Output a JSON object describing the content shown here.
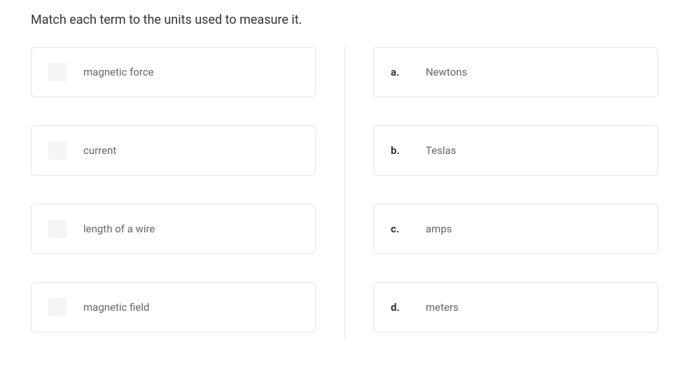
{
  "prompt": "Match each term to the units used to measure it.",
  "terms": [
    {
      "label": "magnetic force"
    },
    {
      "label": "current"
    },
    {
      "label": "length of a wire"
    },
    {
      "label": "magnetic field"
    }
  ],
  "answers": [
    {
      "letter": "a.",
      "text": "Newtons"
    },
    {
      "letter": "b.",
      "text": "Teslas"
    },
    {
      "letter": "c.",
      "text": "amps"
    },
    {
      "letter": "d.",
      "text": "meters"
    }
  ]
}
